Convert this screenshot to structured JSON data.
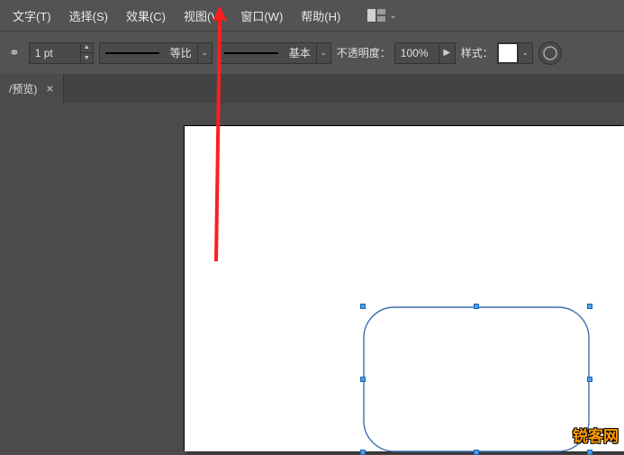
{
  "menu": {
    "items": [
      "文字(T)",
      "选择(S)",
      "效果(C)",
      "视图(V)",
      "窗口(W)",
      "帮助(H)"
    ]
  },
  "options": {
    "stroke_weight": "1 pt",
    "profile_label": "等比",
    "brush_label": "基本",
    "opacity_label": "不透明度：",
    "opacity_value": "100%",
    "style_label": "样式："
  },
  "tab": {
    "title": "/预览)",
    "close": "×"
  },
  "canvas": {
    "shape": {
      "type": "rounded-rectangle",
      "corner_radius": 34,
      "stroke": "#3f6fae",
      "selected": true
    }
  },
  "icons": {
    "chevron_down": "⌄",
    "arrow_right": "▶",
    "step_up": "▲",
    "step_down": "▼",
    "link": "⚭"
  },
  "watermark": "锐客网"
}
